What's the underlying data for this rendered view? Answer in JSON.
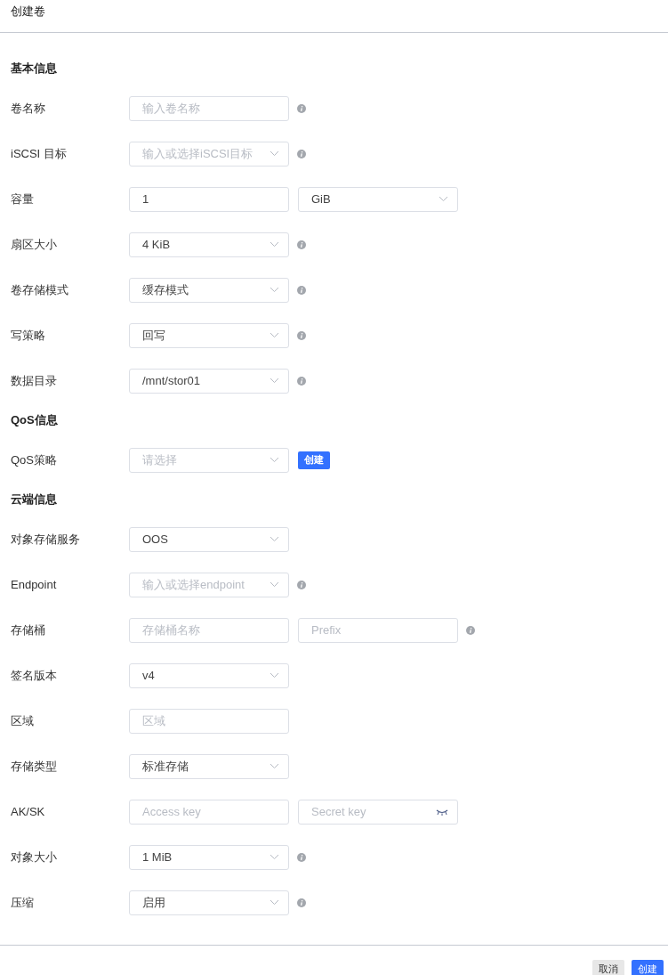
{
  "dialog": {
    "title": "创建卷"
  },
  "sections": [
    {
      "title": "基本信息",
      "rows": [
        {
          "label": "卷名称",
          "info": true,
          "fields": [
            {
              "kind": "input",
              "placeholder": "输入卷名称"
            }
          ]
        },
        {
          "label": "iSCSI 目标",
          "info": true,
          "fields": [
            {
              "kind": "select",
              "placeholder": "输入或选择iSCSI目标"
            }
          ]
        },
        {
          "label": "容量",
          "info": false,
          "fields": [
            {
              "kind": "input",
              "value": "1"
            },
            {
              "kind": "select",
              "value": "GiB"
            }
          ]
        },
        {
          "label": "扇区大小",
          "info": true,
          "fields": [
            {
              "kind": "select",
              "value": "4 KiB"
            }
          ]
        },
        {
          "label": "卷存储模式",
          "info": true,
          "fields": [
            {
              "kind": "select",
              "value": "缓存模式"
            }
          ]
        },
        {
          "label": "写策略",
          "info": true,
          "fields": [
            {
              "kind": "select",
              "value": "回写"
            }
          ]
        },
        {
          "label": "数据目录",
          "info": true,
          "fields": [
            {
              "kind": "select",
              "value": "/mnt/stor01"
            }
          ]
        }
      ]
    },
    {
      "title": "QoS信息",
      "rows": [
        {
          "label": "QoS策略",
          "info": false,
          "button": "创建",
          "fields": [
            {
              "kind": "select",
              "placeholder": "请选择"
            }
          ]
        }
      ]
    },
    {
      "title": "云端信息",
      "rows": [
        {
          "label": "对象存储服务",
          "info": false,
          "fields": [
            {
              "kind": "select",
              "value": "OOS"
            }
          ]
        },
        {
          "label": "Endpoint",
          "info": true,
          "fields": [
            {
              "kind": "select",
              "placeholder": "输入或选择endpoint"
            }
          ]
        },
        {
          "label": "存储桶",
          "info": true,
          "fields": [
            {
              "kind": "input",
              "placeholder": "存储桶名称"
            },
            {
              "kind": "input",
              "placeholder": "Prefix"
            }
          ]
        },
        {
          "label": "签名版本",
          "info": false,
          "fields": [
            {
              "kind": "select",
              "value": "v4"
            }
          ]
        },
        {
          "label": "区域",
          "info": false,
          "fields": [
            {
              "kind": "input",
              "placeholder": "区域"
            }
          ]
        },
        {
          "label": "存储类型",
          "info": false,
          "fields": [
            {
              "kind": "select",
              "value": "标准存储"
            }
          ]
        },
        {
          "label": "AK/SK",
          "info": false,
          "fields": [
            {
              "kind": "input",
              "placeholder": "Access key"
            },
            {
              "kind": "password",
              "placeholder": "Secret key"
            }
          ]
        },
        {
          "label": "对象大小",
          "info": true,
          "fields": [
            {
              "kind": "select",
              "value": "1 MiB"
            }
          ]
        },
        {
          "label": "压缩",
          "info": true,
          "fields": [
            {
              "kind": "select",
              "value": "启用"
            }
          ]
        }
      ]
    }
  ],
  "footer": {
    "buttons": [
      {
        "label": "取消",
        "kind": "secondary"
      },
      {
        "label": "创建",
        "kind": "primary"
      }
    ]
  }
}
